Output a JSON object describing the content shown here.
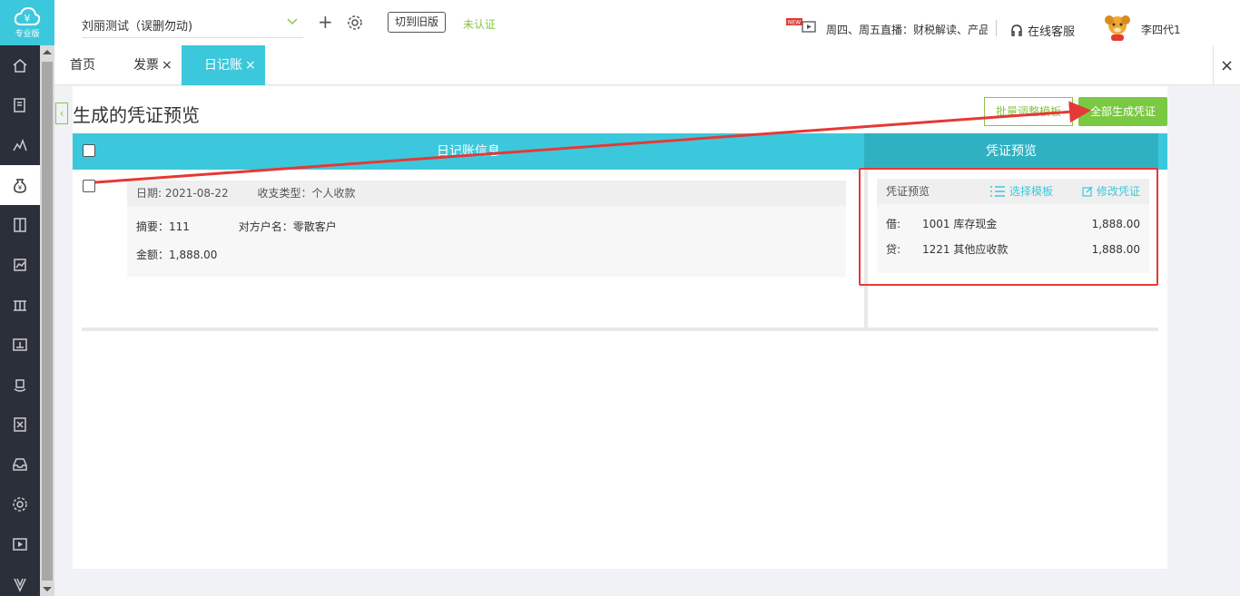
{
  "logo": {
    "version": "专业版"
  },
  "topbar": {
    "company": "刘丽测试（误删勿动)",
    "switch_old": "切到旧版",
    "unverified": "未认证",
    "news_badge": "NEW",
    "broadcast": "周四、周五直播：财税解读、产品",
    "service": "在线客服",
    "username": "李四代1"
  },
  "tabs": [
    {
      "label": "首页"
    },
    {
      "label": "发票"
    },
    {
      "label": "日记账"
    }
  ],
  "tab_close": "×",
  "page": {
    "title": "生成的凭证预览",
    "batch_button": "批量调整模板",
    "generate_all_button": "全部生成凭证",
    "col_journal": "日记账信息",
    "col_voucher": "凭证预览"
  },
  "entry": {
    "date": "日期: 2021-08-22",
    "type": "收支类型：个人收款",
    "summary": "摘要：111",
    "counterparty": "对方户名：零散客户",
    "amount": "金额：1,888.00"
  },
  "voucher": {
    "title": "凭证预览",
    "choose_template": "选择模板",
    "edit_voucher": "修改凭证",
    "lines": [
      {
        "dc": "借:",
        "account": "1001 库存现金",
        "amount": "1,888.00"
      },
      {
        "dc": "贷:",
        "account": "1221 其他应收款",
        "amount": "1,888.00"
      }
    ]
  },
  "colors": {
    "accent": "#3cc8dc",
    "green": "#7ac943",
    "annotation": "#e53935",
    "sidebar": "#2b2f3a"
  }
}
